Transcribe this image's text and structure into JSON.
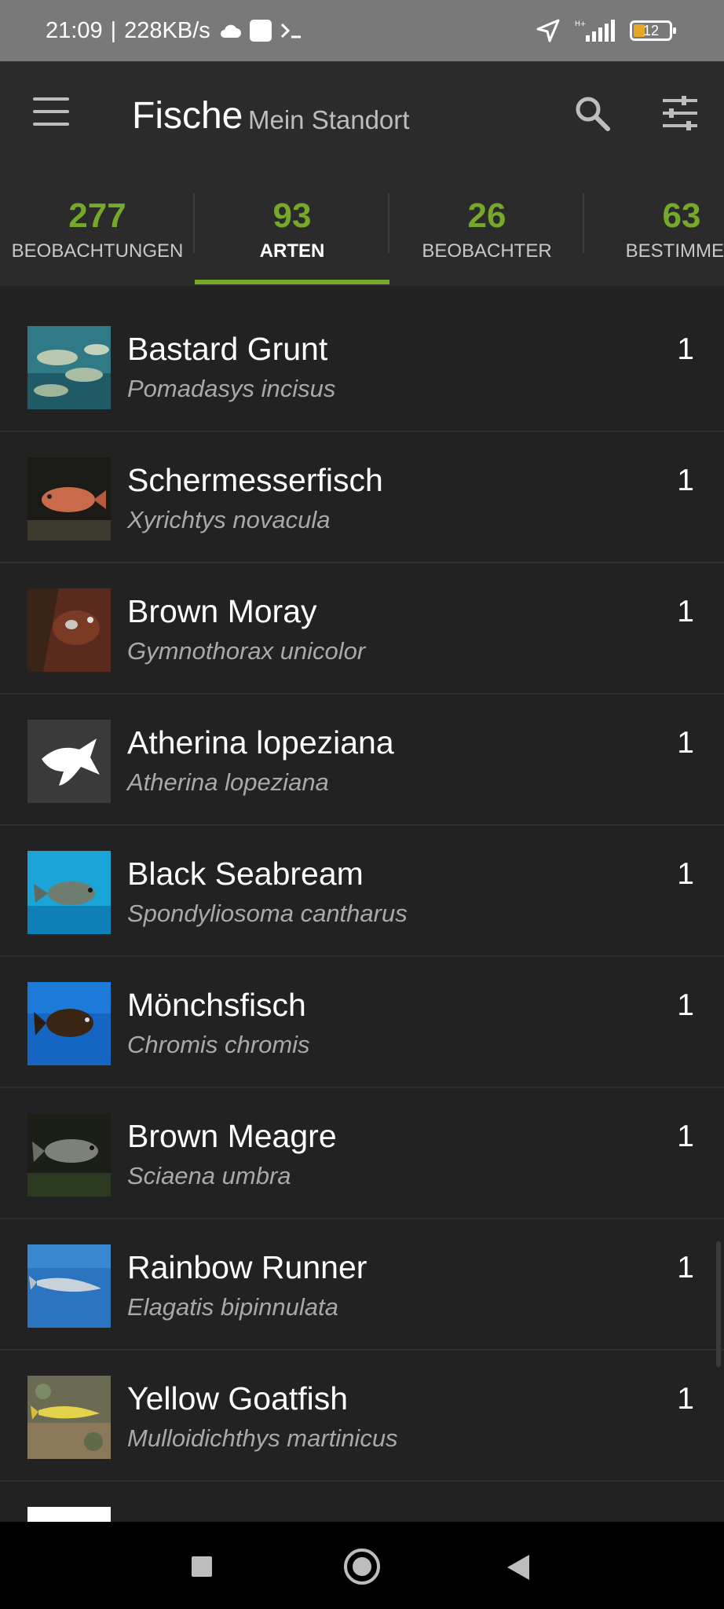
{
  "status_bar": {
    "time": "21:09",
    "speed": "228KB/s",
    "battery": "12",
    "accent": "#e7a82a"
  },
  "header": {
    "title": "Fische",
    "subtitle": "Mein Standort",
    "icons": [
      "menu-icon",
      "search-icon",
      "filter-icon"
    ]
  },
  "tabs": [
    {
      "count": "277",
      "label": "BEOBACHTUNGEN"
    },
    {
      "count": "93",
      "label": "ARTEN"
    },
    {
      "count": "26",
      "label": "BEOBACHTER"
    },
    {
      "count": "63",
      "label": "BESTIMMER"
    }
  ],
  "active_tab": "ARTEN",
  "accent_color": "#75a92a",
  "species": [
    {
      "name": "Bastard Grunt",
      "scientific": "Pomadasys incisus",
      "count": "1"
    },
    {
      "name": "Schermesserfisch",
      "scientific": "Xyrichtys novacula",
      "count": "1"
    },
    {
      "name": "Brown Moray",
      "scientific": "Gymnothorax unicolor",
      "count": "1"
    },
    {
      "name": "Atherina lopeziana",
      "scientific": "Atherina lopeziana",
      "count": "1"
    },
    {
      "name": "Black Seabream",
      "scientific": "Spondyliosoma cantharus",
      "count": "1"
    },
    {
      "name": "Mönchsfisch",
      "scientific": "Chromis chromis",
      "count": "1"
    },
    {
      "name": "Brown Meagre",
      "scientific": "Sciaena umbra",
      "count": "1"
    },
    {
      "name": "Rainbow Runner",
      "scientific": "Elagatis bipinnulata",
      "count": "1"
    },
    {
      "name": "Yellow Goatfish",
      "scientific": "Mulloidichthys martinicus",
      "count": "1"
    }
  ]
}
